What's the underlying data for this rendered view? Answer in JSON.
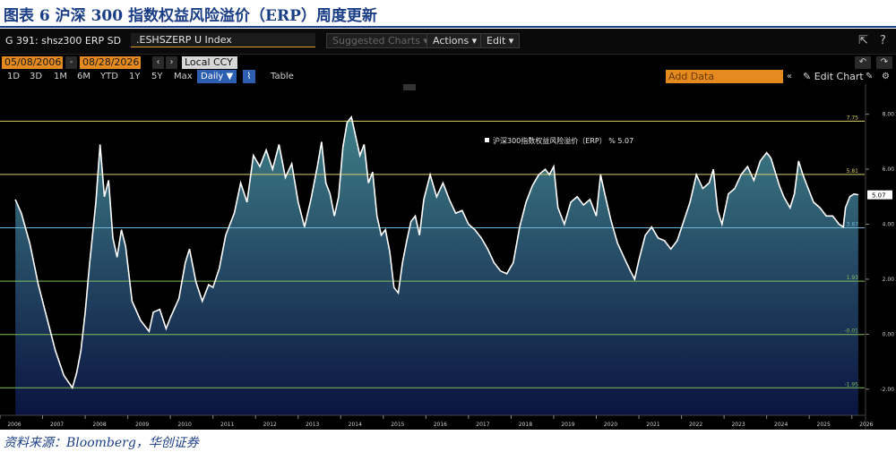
{
  "figure": {
    "title": "图表 6  沪深 300 指数权益风险溢价（ERP）周度更新",
    "source": "资料来源：Bloomberg，华创证券"
  },
  "terminal": {
    "ticker": "G 391: shsz300 ERP SD",
    "security": ".ESHSZERP U Index",
    "buttons": {
      "suggested": "Suggested Charts ▾",
      "actions": "Actions ▾",
      "edit": "Edit ▾"
    },
    "start_date": "05/08/2006",
    "end_date": "08/28/2026",
    "currency": "Local CCY",
    "periods": [
      "1D",
      "3D",
      "1M",
      "6M",
      "YTD",
      "1Y",
      "5Y",
      "Max"
    ],
    "frequency": "Daily ▼",
    "table_label": "Table",
    "add_data_placeholder": "Add Data",
    "edit_chart": "Edit Chart",
    "icons": [
      "share-icon",
      "help-icon",
      "undo-icon",
      "redo-icon",
      "chart-type-icon",
      "collapse-icon",
      "pencil-icon",
      "settings-icon"
    ]
  },
  "colors": {
    "accent_orange": "#e58a1e",
    "line_white": "#ffffff",
    "area_top": "#3f7f88",
    "area_bottom": "#0b1440"
  },
  "chart_data": {
    "type": "area",
    "series": [
      {
        "name": "沪深300指数权益风险溢价（ERP） % 5.07",
        "points": [
          [
            2006.36,
            4.9
          ],
          [
            2006.5,
            4.4
          ],
          [
            2006.7,
            3.3
          ],
          [
            2006.9,
            1.8
          ],
          [
            2007.1,
            0.6
          ],
          [
            2007.3,
            -0.6
          ],
          [
            2007.5,
            -1.5
          ],
          [
            2007.7,
            -1.95
          ],
          [
            2007.8,
            -1.4
          ],
          [
            2007.9,
            -0.6
          ],
          [
            2008.0,
            0.8
          ],
          [
            2008.1,
            2.5
          ],
          [
            2008.25,
            4.8
          ],
          [
            2008.35,
            6.9
          ],
          [
            2008.45,
            5.0
          ],
          [
            2008.55,
            5.6
          ],
          [
            2008.65,
            3.5
          ],
          [
            2008.75,
            2.8
          ],
          [
            2008.85,
            3.8
          ],
          [
            2008.95,
            3.2
          ],
          [
            2009.1,
            1.2
          ],
          [
            2009.3,
            0.5
          ],
          [
            2009.5,
            0.1
          ],
          [
            2009.6,
            0.8
          ],
          [
            2009.75,
            0.9
          ],
          [
            2009.9,
            0.2
          ],
          [
            2010.0,
            0.6
          ],
          [
            2010.2,
            1.3
          ],
          [
            2010.35,
            2.6
          ],
          [
            2010.45,
            3.1
          ],
          [
            2010.6,
            1.9
          ],
          [
            2010.75,
            1.2
          ],
          [
            2010.9,
            1.8
          ],
          [
            2011.0,
            1.7
          ],
          [
            2011.15,
            2.4
          ],
          [
            2011.3,
            3.6
          ],
          [
            2011.5,
            4.4
          ],
          [
            2011.65,
            5.5
          ],
          [
            2011.8,
            4.8
          ],
          [
            2011.95,
            6.5
          ],
          [
            2012.1,
            6.1
          ],
          [
            2012.25,
            6.7
          ],
          [
            2012.4,
            6.0
          ],
          [
            2012.55,
            6.9
          ],
          [
            2012.7,
            5.7
          ],
          [
            2012.85,
            6.2
          ],
          [
            2013.0,
            4.8
          ],
          [
            2013.15,
            3.9
          ],
          [
            2013.3,
            4.9
          ],
          [
            2013.45,
            6.1
          ],
          [
            2013.55,
            7.0
          ],
          [
            2013.65,
            5.5
          ],
          [
            2013.75,
            5.1
          ],
          [
            2013.85,
            4.3
          ],
          [
            2013.95,
            5.0
          ],
          [
            2014.05,
            6.8
          ],
          [
            2014.15,
            7.7
          ],
          [
            2014.25,
            7.9
          ],
          [
            2014.35,
            7.2
          ],
          [
            2014.45,
            6.5
          ],
          [
            2014.55,
            6.9
          ],
          [
            2014.65,
            5.5
          ],
          [
            2014.75,
            5.9
          ],
          [
            2014.85,
            4.3
          ],
          [
            2014.95,
            3.6
          ],
          [
            2015.05,
            3.8
          ],
          [
            2015.15,
            3.0
          ],
          [
            2015.25,
            1.7
          ],
          [
            2015.35,
            1.5
          ],
          [
            2015.45,
            2.6
          ],
          [
            2015.55,
            3.4
          ],
          [
            2015.65,
            4.1
          ],
          [
            2015.75,
            4.3
          ],
          [
            2015.85,
            3.6
          ],
          [
            2015.95,
            4.9
          ],
          [
            2016.1,
            5.8
          ],
          [
            2016.25,
            5.0
          ],
          [
            2016.4,
            5.5
          ],
          [
            2016.55,
            4.9
          ],
          [
            2016.7,
            4.4
          ],
          [
            2016.85,
            4.5
          ],
          [
            2017.0,
            4.0
          ],
          [
            2017.15,
            3.8
          ],
          [
            2017.3,
            3.5
          ],
          [
            2017.45,
            3.1
          ],
          [
            2017.6,
            2.6
          ],
          [
            2017.75,
            2.3
          ],
          [
            2017.9,
            2.2
          ],
          [
            2018.05,
            2.6
          ],
          [
            2018.2,
            3.9
          ],
          [
            2018.35,
            4.8
          ],
          [
            2018.5,
            5.4
          ],
          [
            2018.65,
            5.8
          ],
          [
            2018.8,
            6.0
          ],
          [
            2018.9,
            5.8
          ],
          [
            2019.0,
            6.1
          ],
          [
            2019.1,
            4.6
          ],
          [
            2019.25,
            4.0
          ],
          [
            2019.4,
            4.8
          ],
          [
            2019.55,
            5.0
          ],
          [
            2019.7,
            4.7
          ],
          [
            2019.85,
            4.9
          ],
          [
            2020.0,
            4.3
          ],
          [
            2020.1,
            5.8
          ],
          [
            2020.2,
            5.1
          ],
          [
            2020.35,
            4.1
          ],
          [
            2020.5,
            3.3
          ],
          [
            2020.65,
            2.8
          ],
          [
            2020.8,
            2.3
          ],
          [
            2020.9,
            2.0
          ],
          [
            2021.0,
            2.7
          ],
          [
            2021.15,
            3.6
          ],
          [
            2021.3,
            3.9
          ],
          [
            2021.45,
            3.5
          ],
          [
            2021.6,
            3.4
          ],
          [
            2021.75,
            3.1
          ],
          [
            2021.9,
            3.4
          ],
          [
            2022.05,
            4.1
          ],
          [
            2022.2,
            4.8
          ],
          [
            2022.35,
            5.8
          ],
          [
            2022.5,
            5.3
          ],
          [
            2022.65,
            5.5
          ],
          [
            2022.75,
            6.0
          ],
          [
            2022.85,
            4.5
          ],
          [
            2022.95,
            4.0
          ],
          [
            2023.1,
            5.1
          ],
          [
            2023.25,
            5.3
          ],
          [
            2023.4,
            5.8
          ],
          [
            2023.55,
            6.1
          ],
          [
            2023.7,
            5.6
          ],
          [
            2023.85,
            6.3
          ],
          [
            2024.0,
            6.6
          ],
          [
            2024.1,
            6.4
          ],
          [
            2024.2,
            5.9
          ],
          [
            2024.3,
            5.4
          ],
          [
            2024.4,
            5.0
          ],
          [
            2024.55,
            4.6
          ],
          [
            2024.65,
            5.1
          ],
          [
            2024.75,
            6.3
          ],
          [
            2024.85,
            5.8
          ],
          [
            2024.95,
            5.4
          ],
          [
            2025.1,
            4.8
          ],
          [
            2025.25,
            4.6
          ],
          [
            2025.4,
            4.3
          ],
          [
            2025.55,
            4.3
          ],
          [
            2025.7,
            4.0
          ],
          [
            2025.8,
            3.9
          ],
          [
            2025.85,
            4.6
          ],
          [
            2025.95,
            5.0
          ],
          [
            2026.05,
            5.1
          ],
          [
            2026.15,
            5.07
          ]
        ]
      }
    ],
    "reference_lines": [
      {
        "value": 7.75,
        "label": "7.75",
        "color": "#d8d26a"
      },
      {
        "value": 5.81,
        "label": "5.81",
        "color": "#d8d26a"
      },
      {
        "value": 3.87,
        "label": "3.87",
        "color": "#6db8d8"
      },
      {
        "value": 1.93,
        "label": "1.93",
        "color": "#7fbf5a"
      },
      {
        "value": -0.01,
        "label": "-0.01",
        "color": "#7fbf5a"
      },
      {
        "value": -1.95,
        "label": "-1.95",
        "color": "#7fbf5a"
      }
    ],
    "last_value_label": "5.07",
    "y_ticks": [
      8,
      6,
      4,
      2,
      0,
      -2
    ],
    "y_tick_labels": [
      "8.00",
      "6.00",
      "4.00",
      "2.00",
      "0.00",
      "-2.00"
    ],
    "x_ticks": [
      2006,
      2007,
      2008,
      2009,
      2010,
      2011,
      2012,
      2013,
      2014,
      2015,
      2016,
      2017,
      2018,
      2019,
      2020,
      2021,
      2022,
      2023,
      2024,
      2025,
      2026
    ],
    "xlim": [
      2006.0,
      2026.3
    ],
    "ylim": [
      -2.95,
      8.9
    ],
    "grid": false,
    "legend_placement": "top-center"
  }
}
